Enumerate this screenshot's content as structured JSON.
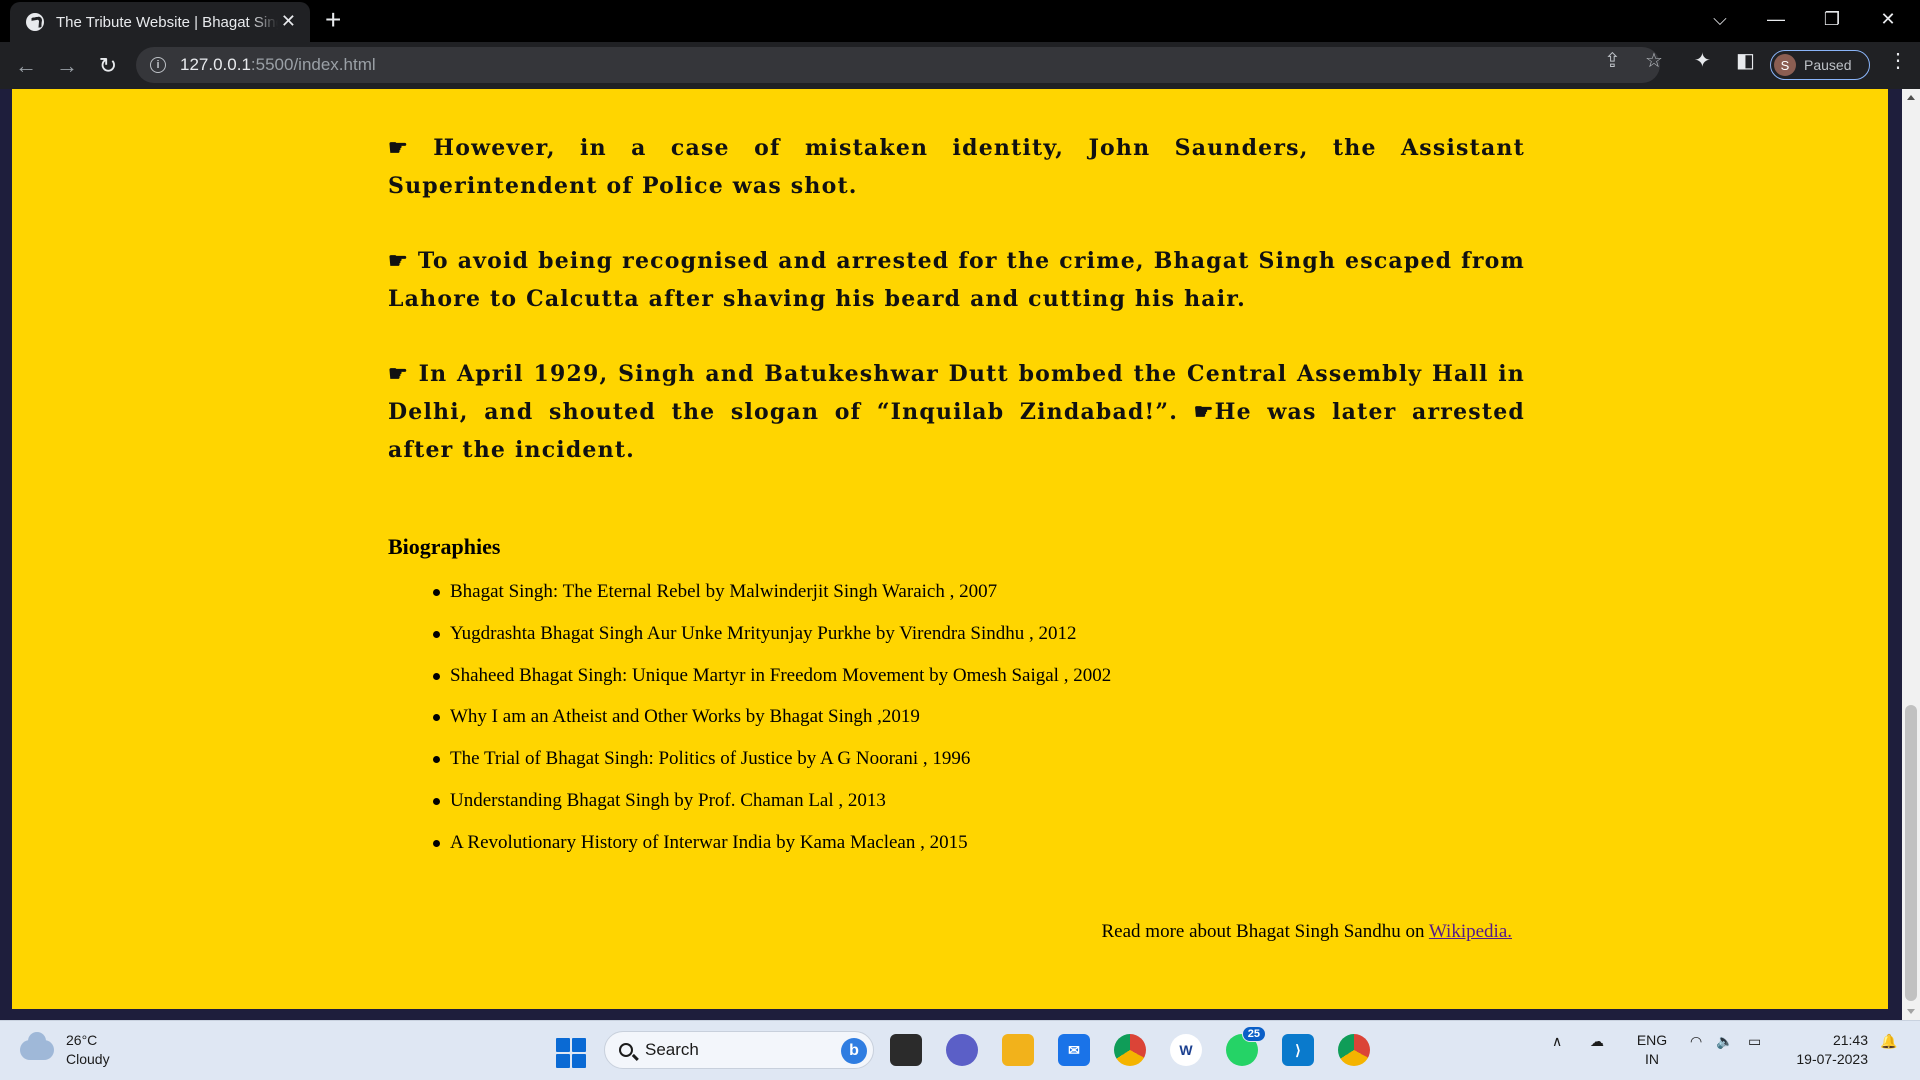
{
  "browser": {
    "tab_title": "The Tribute Website | Bhagat Singh",
    "url_host": "127.0.0.1",
    "url_path": ":5500/index.html",
    "profile_initial": "S",
    "profile_status": "Paused"
  },
  "content": {
    "facts": [
      "☛ However, in a case of mistaken identity, John Saunders, the Assistant Superintendent of Police was shot.",
      "☛ To avoid being recognised and arrested for the crime, Bhagat Singh escaped from Lahore to Calcutta after shaving his beard and cutting his hair.",
      "☛ In April 1929, Singh and Batukeshwar Dutt bombed the Central Assembly Hall in Delhi, and shouted the slogan of “Inquilab Zindabad!”. ☛He was later arrested after the incident."
    ],
    "biographies_heading": "Biographies",
    "biographies": [
      "Bhagat Singh: The Eternal Rebel by Malwinderjit Singh Waraich , 2007",
      "Yugdrashta Bhagat Singh Aur Unke Mrityunjay Purkhe by Virendra Sindhu , 2012",
      "Shaheed Bhagat Singh: Unique Martyr in Freedom Movement by Omesh Saigal , 2002",
      "Why I am an Atheist and Other Works by Bhagat Singh ,2019",
      "The Trial of Bhagat Singh: Politics of Justice by A G Noorani , 1996",
      "Understanding Bhagat Singh by Prof. Chaman Lal , 2013",
      "A Revolutionary History of Interwar India by Kama Maclean , 2015"
    ],
    "read_more_text": "Read more about Bhagat Singh Sandhu on ",
    "read_more_link": "Wikipedia."
  },
  "taskbar": {
    "temperature": "26°C",
    "weather": "Cloudy",
    "search_label": "Search",
    "whatsapp_badge": "25",
    "lang_primary": "ENG",
    "lang_region": "IN",
    "time": "21:43",
    "date": "19-07-2023"
  },
  "colors": {
    "page_background": "#ffd500",
    "page_frame": "#1e1e3c",
    "link": "#551a8b"
  }
}
